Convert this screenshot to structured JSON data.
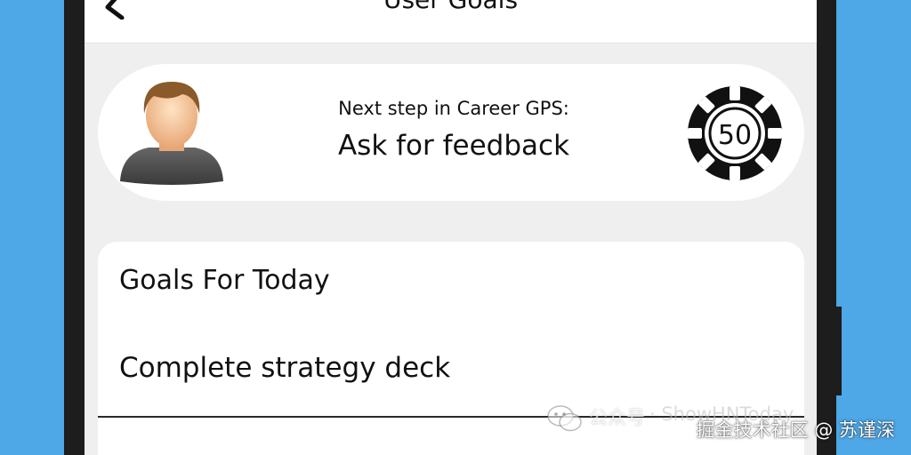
{
  "header": {
    "title": "User Goals"
  },
  "career": {
    "subtitle": "Next step in Career GPS:",
    "next_step": "Ask for feedback",
    "chip_value": "50"
  },
  "goals": {
    "heading": "Goals For Today",
    "items": [
      "Complete strategy deck"
    ]
  },
  "watermark": {
    "account": "公众号",
    "brand": "· ShowHNToday",
    "credit": "掘金技术社区 @ 苏谨深"
  },
  "icons": {
    "back": "chevron-left-icon",
    "avatar": "user-avatar-icon",
    "chip": "poker-chip-icon",
    "wechat": "wechat-icon"
  },
  "colors": {
    "background": "#4ea7e6",
    "frame": "#1d1d1d",
    "screen": "#efefef",
    "card": "#ffffff",
    "text": "#111111"
  }
}
